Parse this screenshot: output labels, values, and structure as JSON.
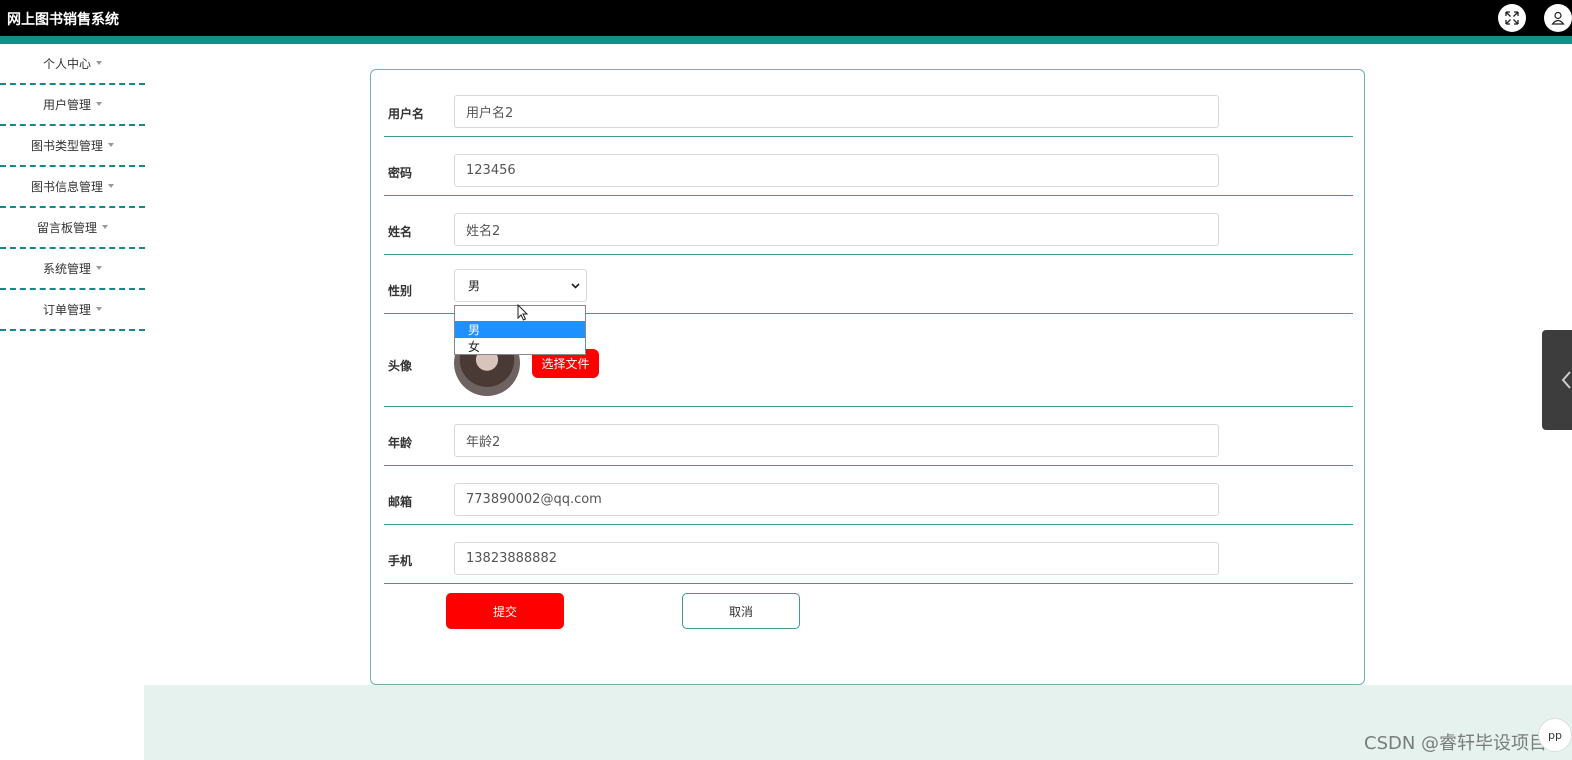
{
  "header": {
    "title": "网上图书销售系统"
  },
  "sidebar": {
    "items": [
      {
        "label": "个人中心"
      },
      {
        "label": "用户管理"
      },
      {
        "label": "图书类型管理"
      },
      {
        "label": "图书信息管理"
      },
      {
        "label": "留言板管理"
      },
      {
        "label": "系统管理"
      },
      {
        "label": "订单管理"
      }
    ]
  },
  "form": {
    "username": {
      "label": "用户名",
      "value": "用户名2"
    },
    "password": {
      "label": "密码",
      "value": "123456"
    },
    "name": {
      "label": "姓名",
      "value": "姓名2"
    },
    "gender": {
      "label": "性别",
      "value": "男",
      "options": [
        "男",
        "女"
      ]
    },
    "avatar": {
      "label": "头像",
      "button": "选择文件"
    },
    "age": {
      "label": "年龄",
      "value": "年龄2"
    },
    "email": {
      "label": "邮箱",
      "value": "773890002@qq.com"
    },
    "phone": {
      "label": "手机",
      "value": "13823888882"
    },
    "submit": "提交",
    "cancel": "取消"
  },
  "misc": {
    "bottom_widget": "pp",
    "watermark": "CSDN @睿轩毕设项目"
  },
  "colors": {
    "accent": "#0f8f86",
    "primary_button": "#ff0000",
    "header_bg": "#000000",
    "footer_bg": "#e6f2ee"
  }
}
